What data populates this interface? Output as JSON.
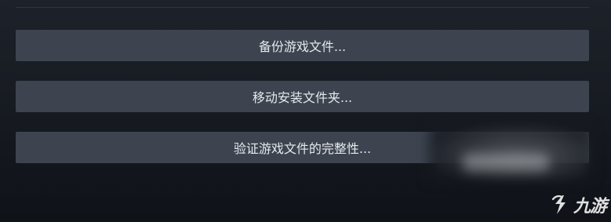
{
  "buttons": {
    "backup": "备份游戏文件...",
    "move": "移动安装文件夹...",
    "verify": "验证游戏文件的完整性..."
  },
  "watermark": {
    "text": "九游"
  },
  "colors": {
    "button_bg": "#3d4450",
    "button_text": "#e6e9ed",
    "background": "#171b22"
  }
}
